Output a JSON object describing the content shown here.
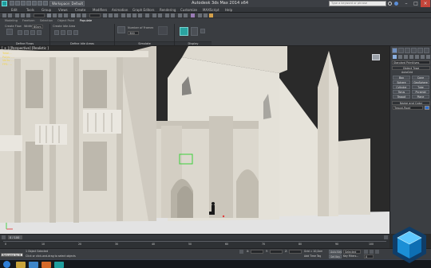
{
  "titlebar": {
    "workspace": "Workspace: Default",
    "title": "Autodesk 3ds Max 2014 x64",
    "search_placeholder": "Type a keyword or phrase",
    "min": "–",
    "max": "□",
    "close": "×"
  },
  "menu": {
    "items": [
      "Edit",
      "Tools",
      "Group",
      "Views",
      "Create",
      "Modifiers",
      "Animation",
      "Graph Editors",
      "Rendering",
      "Customize",
      "MAXScript",
      "Help"
    ]
  },
  "ribbon": {
    "tabs": [
      "Modeling",
      "Freeform",
      "Selection",
      "Object Paint",
      "Populate"
    ],
    "create_flow": "Create Flow",
    "width_label": "Width:",
    "width_value": "60cm",
    "create_idle_area": "Create Idle Area",
    "num_frames_label": "Number of Frames:",
    "num_frames_value": "300",
    "define_flows": "Define Flows",
    "define_idle_areas": "Define Idle Areas",
    "simulate": "Simulate",
    "display": "Display"
  },
  "viewport": {
    "label": "[ + ] [Perspective] [Realistic ]",
    "stats": [
      "Total…",
      "Polys: …",
      "Verts: …",
      "",
      "FPS: …"
    ]
  },
  "command_panel": {
    "dropdown": "Standard Primitives",
    "object_type": "Object Type",
    "autogrid": "AutoGrid",
    "buttons": [
      "Box",
      "Cone",
      "Sphere",
      "GeoSphere",
      "Cylinder",
      "Tube",
      "Torus",
      "Pyramid",
      "Teapot",
      "Plane"
    ],
    "name_and_color": "Name and Color",
    "name_value": "Teapot-Road"
  },
  "time": {
    "slider": "0 / 100",
    "ticks": [
      "0",
      "10",
      "20",
      "30",
      "40",
      "50",
      "60",
      "70",
      "80",
      "90",
      "100"
    ]
  },
  "status": {
    "selected": "1 Object Selected",
    "prompt": "Click or click-and-drag to select objects",
    "welcome": "Welcome to M",
    "x_label": "X:",
    "y_label": "Y:",
    "z_label": "Z:",
    "grid": "Grid = 10,0cm",
    "add_time_tag": "Add Time Tag",
    "auto_key": "Auto Key",
    "selected_dropdown": "Selected",
    "set_key": "Set Key",
    "key_filters": "Key Filters...",
    "frame_value": "0"
  },
  "colors": {
    "background": "#2b2b2b",
    "ui_dark": "#3a3d41",
    "building": "#ddd9cf",
    "building_shadow": "#b5b0a4",
    "sky": "#2a2a2a",
    "ground": "#e3e3e3",
    "accent": "#1f7ad9",
    "selection_green": "#3bd13b"
  }
}
